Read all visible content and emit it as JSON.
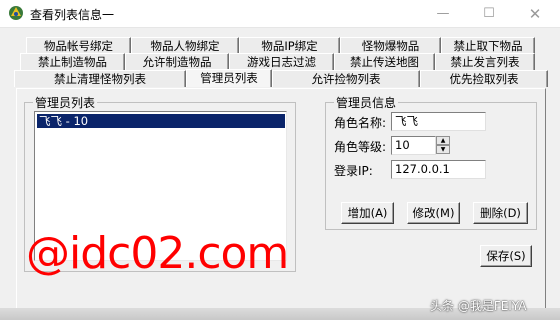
{
  "window": {
    "title": "查看列表信息一",
    "min": "—",
    "max": "☐",
    "close": "✕"
  },
  "tabs": {
    "row1": [
      "物品帐号绑定",
      "物品人物绑定",
      "物品IP绑定",
      "怪物爆物品",
      "禁止取下物品"
    ],
    "row2": [
      "禁止制造物品",
      "允许制造物品",
      "游戏日志过滤",
      "禁止传送地图",
      "禁止发言列表"
    ],
    "row3": [
      "禁止清理怪物列表",
      "管理员列表",
      "允许捡物列表",
      "优先捡取列表"
    ]
  },
  "admin_list": {
    "group_label": "管理员列表",
    "items": [
      "飞飞 - 10"
    ]
  },
  "admin_info": {
    "group_label": "管理员信息",
    "name_label": "角色名称:",
    "name_value": "飞飞",
    "level_label": "角色等级:",
    "level_value": "10",
    "ip_label": "登录IP:",
    "ip_value": "127.0.0.1"
  },
  "buttons": {
    "add": "增加(A)",
    "edit": "修改(M)",
    "delete": "删除(D)",
    "save": "保存(S)"
  },
  "watermark": "@idc02.com",
  "credit": "头条 @我是FEIYA",
  "colors": {
    "selection": "#0a246a",
    "watermark": "#ff0000"
  }
}
